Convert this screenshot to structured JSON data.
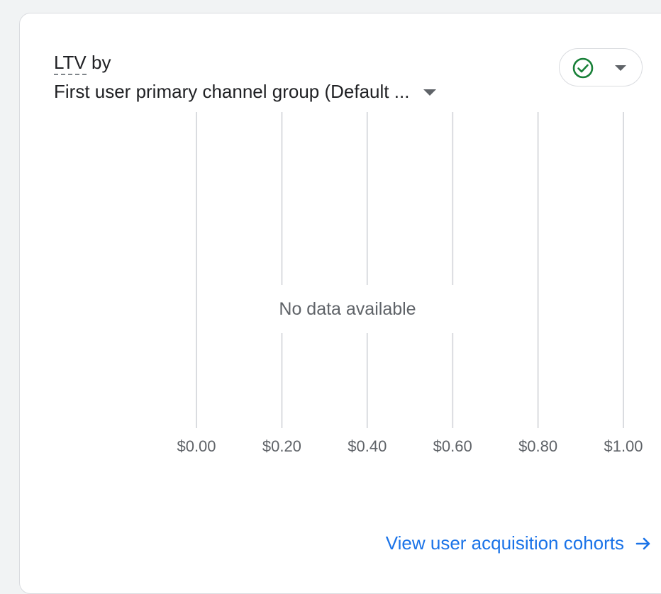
{
  "card": {
    "metric_label": "LTV",
    "by_label": "by",
    "dimension_label": "First user primary channel group (Default ...",
    "status_icon": "check-circle-icon",
    "status_color": "#188038",
    "no_data_text": "No data available",
    "footer_link_text": "View user acquisition cohorts",
    "footer_link_icon": "arrow-right-icon",
    "link_color": "#1a73e8"
  },
  "chart_data": {
    "type": "bar",
    "orientation": "horizontal",
    "categories": [],
    "values": [],
    "x_ticks": [
      "$0.00",
      "$0.20",
      "$0.40",
      "$0.60",
      "$0.80",
      "$1.00"
    ],
    "xlim": [
      0,
      1
    ],
    "grid": true,
    "title": "",
    "xlabel": "",
    "ylabel": ""
  }
}
